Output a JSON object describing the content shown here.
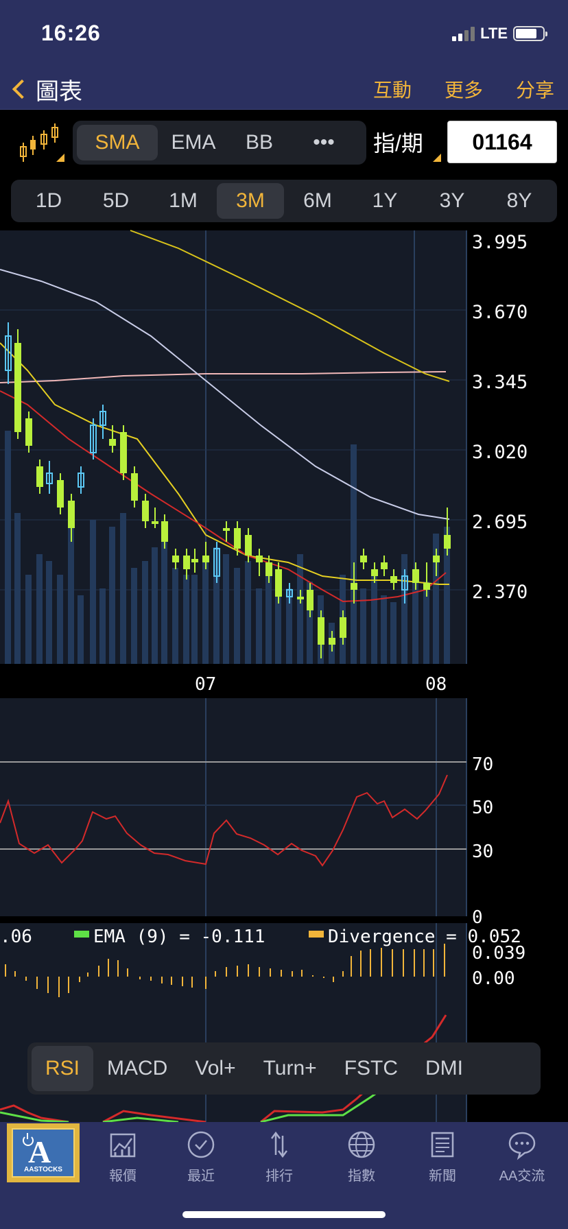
{
  "status": {
    "time": "16:26",
    "network": "LTE"
  },
  "nav": {
    "title": "圖表",
    "actions": [
      "互動",
      "更多",
      "分享"
    ]
  },
  "toolbar": {
    "indicators": [
      "SMA",
      "EMA",
      "BB",
      "•••"
    ],
    "active_indicator": "SMA",
    "period_label": "指/期",
    "stock_code": "01164"
  },
  "ranges": [
    "1D",
    "5D",
    "1M",
    "3M",
    "6M",
    "1Y",
    "3Y",
    "8Y"
  ],
  "active_range": "3M",
  "price_chart": {
    "y_ticks": [
      "3.995",
      "3.670",
      "3.345",
      "3.020",
      "2.695",
      "2.370"
    ],
    "x_labels": [
      "07",
      "08"
    ]
  },
  "rsi_chart": {
    "y_ticks": [
      "70",
      "50",
      "30",
      "0"
    ]
  },
  "macd_chart": {
    "legend_left": ".06",
    "ema_label": "EMA (9) = -0.111",
    "div_label": "Divergence = 0.052",
    "y_ticks": [
      "0.039",
      "0.00"
    ],
    "ema_color": "#5ee046",
    "div_color": "#f2b53a"
  },
  "indicator_tabs": [
    "RSI",
    "MACD",
    "Vol+",
    "Turn+",
    "FSTC",
    "DMI"
  ],
  "active_indicator_tab": "RSI",
  "bottom_nav": [
    "報價",
    "最近",
    "排行",
    "指數",
    "新聞",
    "AA交流"
  ],
  "logo_text": "AASTOCKS",
  "colors": {
    "accent": "#f2b53a",
    "nav_bg": "#2b3060",
    "up_candle": "#5bc8f5",
    "down_candle": "#b9f03c"
  }
}
